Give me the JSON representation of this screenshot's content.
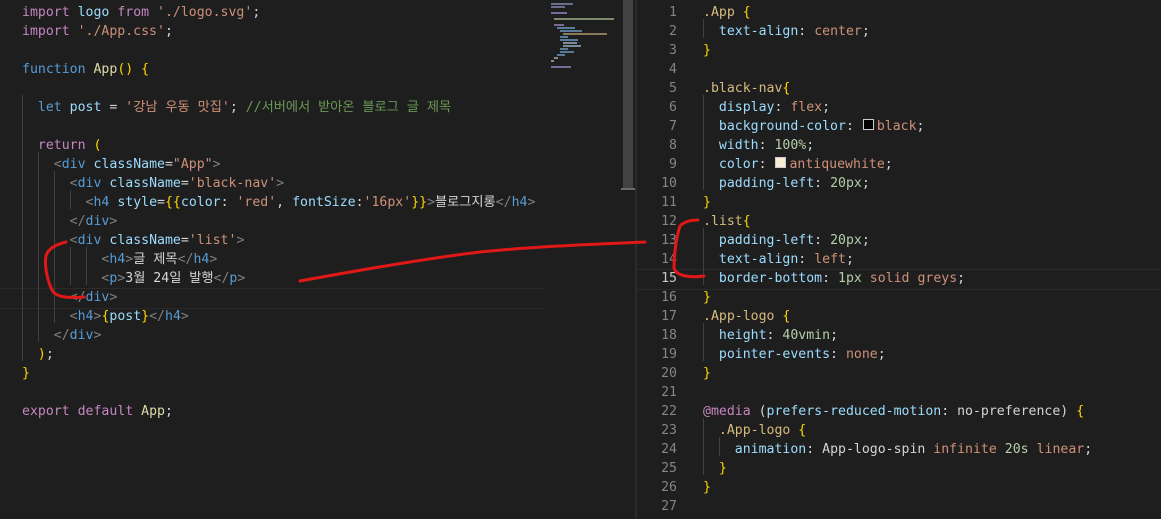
{
  "left_editor": {
    "lines": [
      "import logo from './logo.svg';",
      "import './App.css';",
      "",
      "function App() {",
      "",
      "  let post = '강남 우동 맛집'; //서버에서 받아온 블로그 글 제목",
      "",
      "  return (",
      "    <div className=\"App\">",
      "      <div className='black-nav'>",
      "        <h4 style={{color: 'red', fontSize:'16px'}}>블로그지롱</h4>",
      "      </div>",
      "      <div className='list'>",
      "          <h4>글 제목</h4>",
      "          <p>3월 24일 발행</p>",
      "      </div>",
      "      <h4>{post}</h4>",
      "    </div>",
      "  );",
      "}",
      "",
      "export default App;"
    ]
  },
  "right_editor": {
    "line_numbers": [
      "1",
      "2",
      "3",
      "4",
      "5",
      "6",
      "7",
      "8",
      "9",
      "10",
      "11",
      "12",
      "13",
      "14",
      "15",
      "16",
      "17",
      "18",
      "19",
      "20",
      "21",
      "22",
      "23",
      "24",
      "25",
      "26",
      "27"
    ],
    "active_line": "15",
    "lines": [
      ".App {",
      "  text-align: center;",
      "}",
      "",
      ".black-nav{",
      "  display: flex;",
      "  background-color: black;",
      "  width: 100%;",
      "  color: antiquewhite;",
      "  padding-left: 20px;",
      "}",
      ".list{",
      "  padding-left: 20px;",
      "  text-align: left;",
      "  border-bottom: 1px solid greys;",
      "}",
      ".App-logo {",
      "  height: 40vmin;",
      "  pointer-events: none;",
      "}",
      "",
      "@media (prefers-reduced-motion: no-preference) {",
      "  .App-logo {",
      "    animation: App-logo-spin infinite 20s linear;",
      "  }",
      "}",
      ""
    ],
    "swatch_colors": {
      "black": "#000000",
      "antiquewhite": "#faebd7"
    }
  },
  "theme": {
    "background": "#1e1e1e",
    "annotation_color": "#e02020"
  }
}
